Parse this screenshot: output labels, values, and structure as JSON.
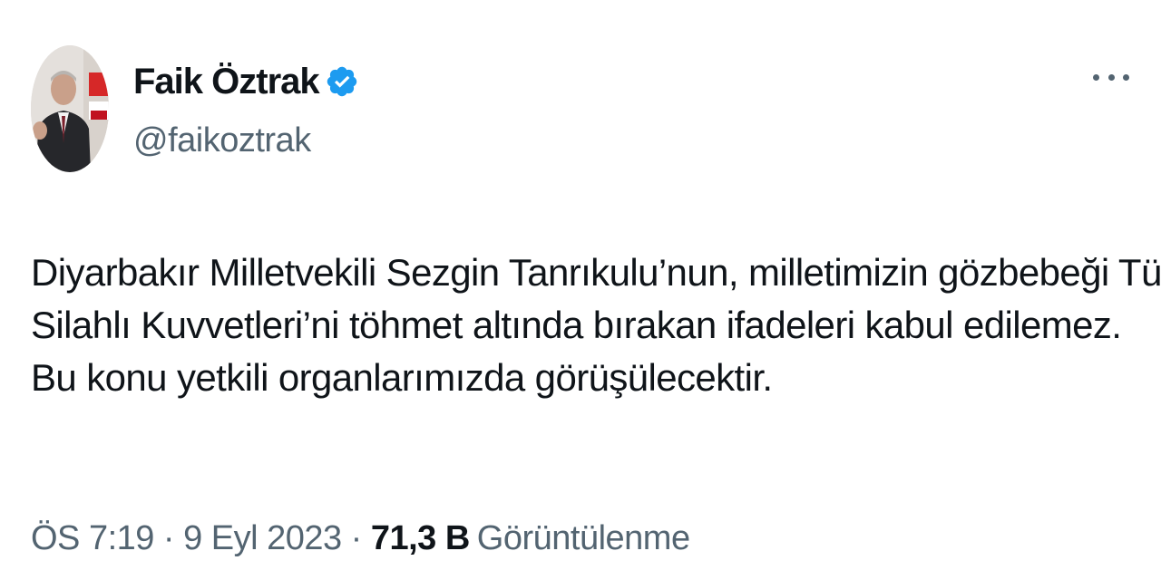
{
  "author": {
    "display_name": "Faik Öztrak",
    "handle": "@faikoztrak",
    "verified": true
  },
  "tweet": {
    "lines": [
      "Diyarbakır Milletvekili Sezgin Tanrıkulu’nun, milletimizin gözbebeği Türk",
      "Silahlı Kuvvetleri’ni töhmet altında bırakan ifadeleri kabul edilemez.",
      "Bu konu yetkili organlarımızda görüşülecektir."
    ]
  },
  "meta": {
    "time": "ÖS 7:19",
    "separator": "·",
    "date": "9 Eyl 2023",
    "views_count": "71,3 B",
    "views_label": "Görüntülenme"
  },
  "colors": {
    "text_primary": "#0f1419",
    "text_secondary": "#536471",
    "verified_blue": "#1d9bf0",
    "background": "#ffffff"
  },
  "icons": {
    "verified": "verified-badge-icon",
    "more": "more-options-icon"
  }
}
